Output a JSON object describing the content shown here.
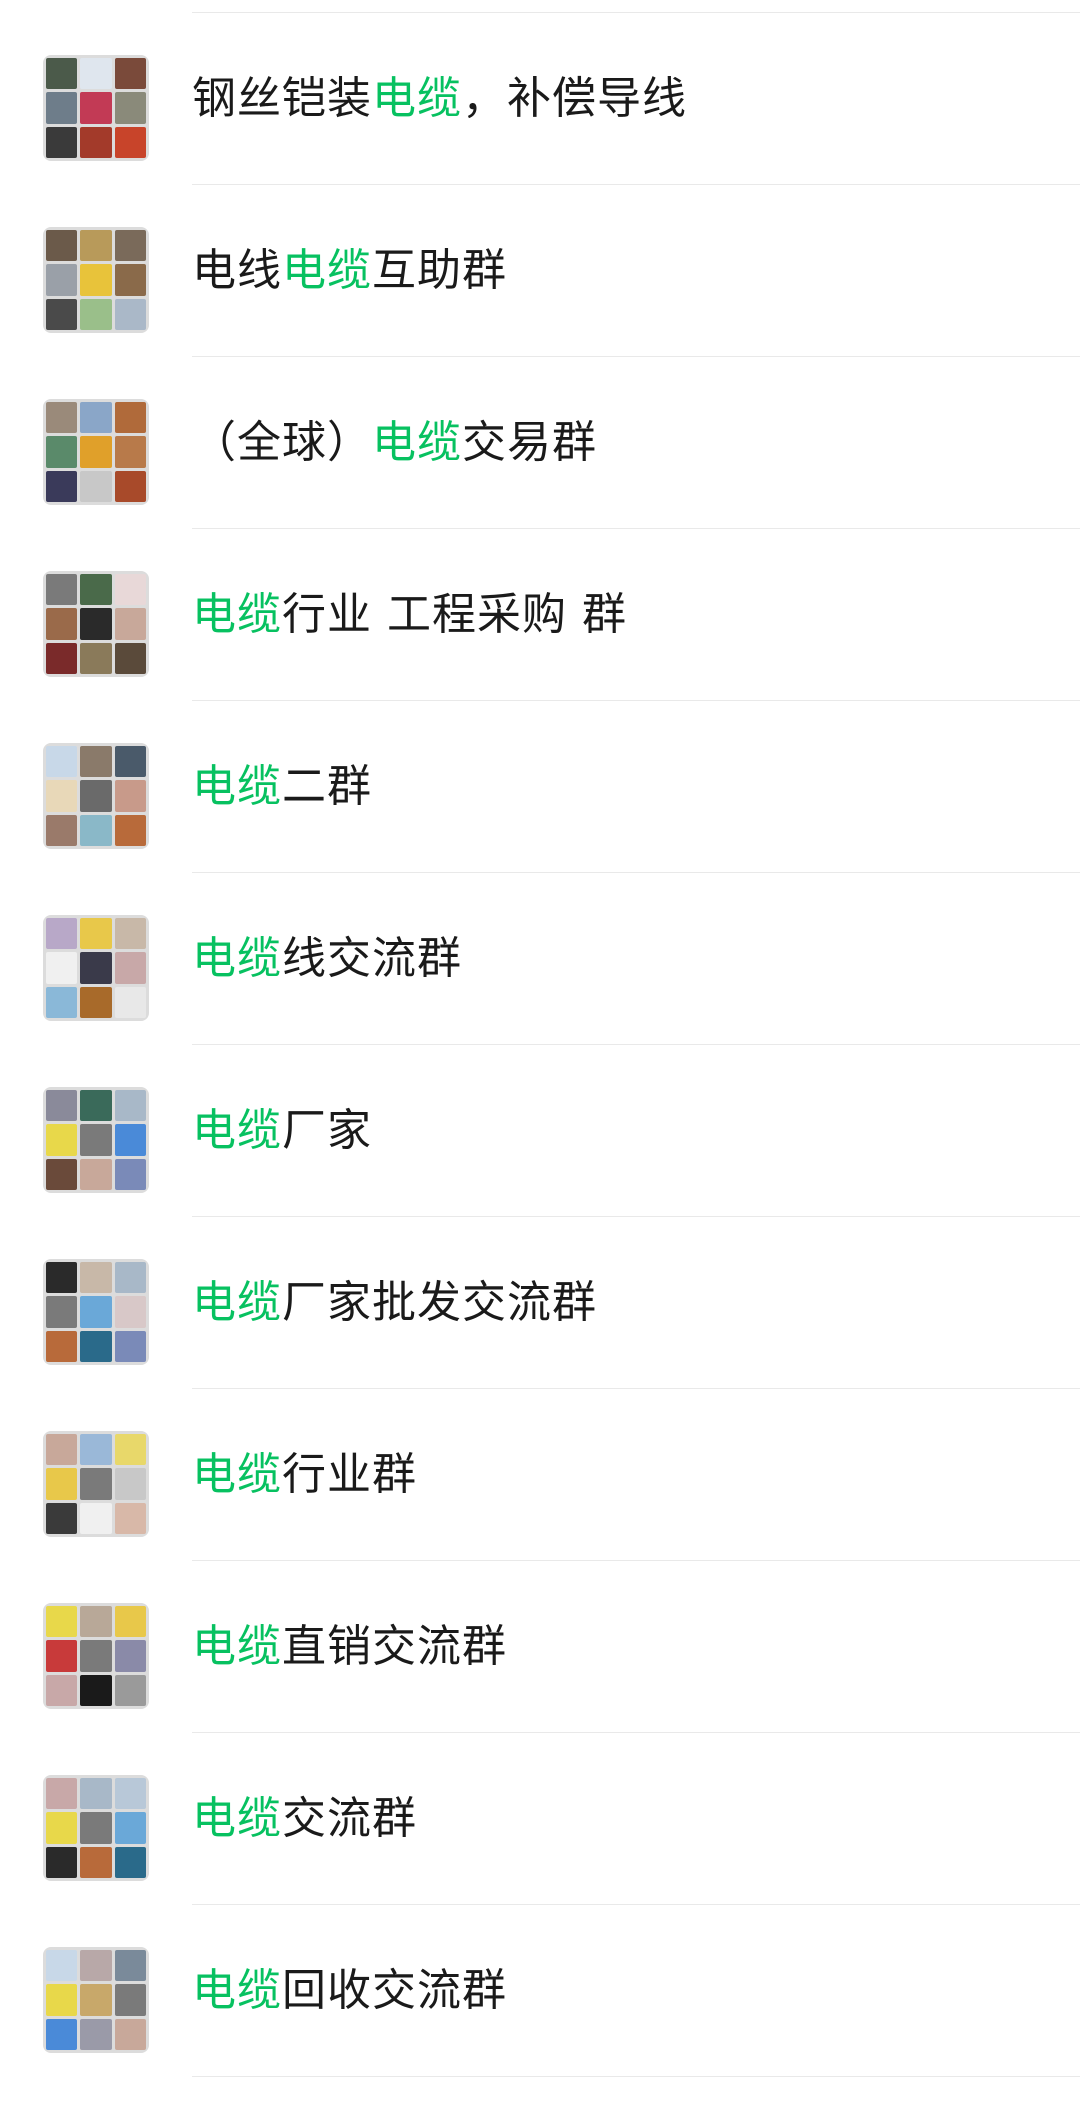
{
  "colors": {
    "highlight": "#07c160",
    "text": "#1a1a1a",
    "divider": "#e9e9e9",
    "background": "#ffffff"
  },
  "search": {
    "keyword": "电缆"
  },
  "groups": [
    {
      "parts": [
        "钢丝铠装",
        "电缆",
        "，补偿导线"
      ],
      "avatar_colors": [
        "#4b5a4a",
        "#dfe6ee",
        "#7a4a3a",
        "#6e7d8a",
        "#c23a55",
        "#8a8a7a",
        "#3a3a3a",
        "#a33a2a",
        "#c8442a"
      ]
    },
    {
      "parts": [
        "电线",
        "电缆",
        "互助群"
      ],
      "avatar_colors": [
        "#6b5a4a",
        "#b89a5a",
        "#7a6a5a",
        "#9aa0a8",
        "#e8c33a",
        "#8a6a4a",
        "#4a4a4a",
        "#9abf8a",
        "#aab8c8"
      ]
    },
    {
      "parts": [
        "（全球）",
        "电缆",
        "交易群"
      ],
      "avatar_colors": [
        "#9a8a7a",
        "#8aa6c8",
        "#b06a3a",
        "#5a8a6a",
        "#e0a02a",
        "#b87a4a",
        "#3a3a5a",
        "#c8c8c8",
        "#a84a2a"
      ]
    },
    {
      "parts": [
        "",
        "电缆",
        "行业   工程采购 群"
      ],
      "avatar_colors": [
        "#7a7a7a",
        "#4a6a4a",
        "#e8d8d8",
        "#9a6a4a",
        "#2a2a2a",
        "#c8a89a",
        "#7a2a2a",
        "#8a7a5a",
        "#5a4a3a"
      ]
    },
    {
      "parts": [
        "",
        "电缆",
        "二群"
      ],
      "avatar_colors": [
        "#c8d8e8",
        "#8a7a6a",
        "#4a5a6a",
        "#e8d8b8",
        "#6a6a6a",
        "#c89a8a",
        "#9a7a6a",
        "#8ab8c8",
        "#b86a3a"
      ]
    },
    {
      "parts": [
        "",
        "电缆",
        "线交流群"
      ],
      "avatar_colors": [
        "#b8a8c8",
        "#e8c84a",
        "#c8b8a8",
        "#f0f0f0",
        "#3a3a4a",
        "#c8a8a8",
        "#8ab8d8",
        "#a86a2a",
        "#e8e8e8"
      ]
    },
    {
      "parts": [
        "",
        "电缆",
        "厂家"
      ],
      "avatar_colors": [
        "#8a8a9a",
        "#3a6a5a",
        "#a8b8c8",
        "#e8d84a",
        "#7a7a7a",
        "#4a8ad8",
        "#6a4a3a",
        "#c8a89a",
        "#7a8ab8"
      ]
    },
    {
      "parts": [
        "",
        "电缆",
        "厂家批发交流群"
      ],
      "avatar_colors": [
        "#2a2a2a",
        "#c8b8a8",
        "#a8b8c8",
        "#7a7a7a",
        "#6aa8d8",
        "#d8c8c8",
        "#b86a3a",
        "#2a6a8a",
        "#7a8ab8"
      ]
    },
    {
      "parts": [
        "",
        "电缆",
        "行业群"
      ],
      "avatar_colors": [
        "#c8a89a",
        "#9ab8d8",
        "#e8d86a",
        "#e8c84a",
        "#7a7a7a",
        "#c8c8c8",
        "#3a3a3a",
        "#f0f0f0",
        "#d8b8a8"
      ]
    },
    {
      "parts": [
        "",
        "电缆",
        "直销交流群"
      ],
      "avatar_colors": [
        "#e8d84a",
        "#b8a898",
        "#e8c84a",
        "#c83a3a",
        "#7a7a7a",
        "#8a8aa8",
        "#c8a8a8",
        "#1a1a1a",
        "#9a9a9a"
      ]
    },
    {
      "parts": [
        "",
        "电缆",
        "交流群"
      ],
      "avatar_colors": [
        "#c8a8a8",
        "#a8b8c8",
        "#b8c8d8",
        "#e8d84a",
        "#7a7a7a",
        "#6aa8d8",
        "#2a2a2a",
        "#b86a3a",
        "#2a6a8a"
      ]
    },
    {
      "parts": [
        "",
        "电缆",
        "回收交流群"
      ],
      "avatar_colors": [
        "#c8d8e8",
        "#b8a8a8",
        "#7a8a9a",
        "#e8d84a",
        "#c8a86a",
        "#7a7a7a",
        "#4a8ad8",
        "#9a9aa8",
        "#c8a89a"
      ]
    }
  ]
}
